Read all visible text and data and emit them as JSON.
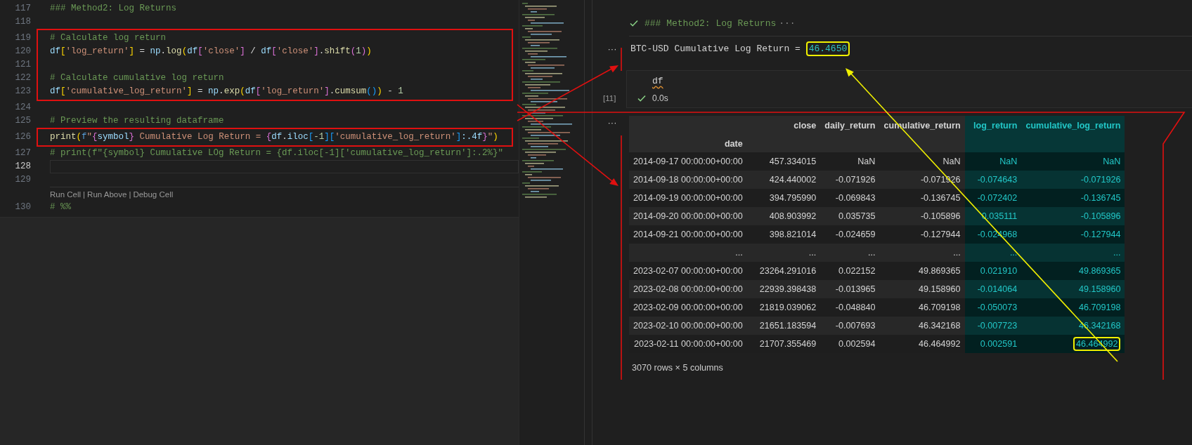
{
  "editor": {
    "groups": [
      {
        "kind": "code",
        "boxed": false,
        "lines": [
          {
            "number": "117",
            "current": false,
            "tokens": [
              {
                "text": "### Method2: Log Returns",
                "kind": "comment"
              }
            ]
          },
          {
            "number": "118",
            "current": false
          }
        ]
      },
      {
        "kind": "code",
        "boxed": true,
        "lines": [
          {
            "number": "119",
            "current": false,
            "tokens": [
              {
                "text": "# Calculate log return",
                "kind": "comment"
              }
            ]
          },
          {
            "number": "120",
            "current": false,
            "tokens": [
              {
                "text": "df",
                "kind": "var"
              },
              {
                "text": "[",
                "kind": "b1"
              },
              {
                "text": "'log_return'",
                "kind": "str"
              },
              {
                "text": "]",
                "kind": "b1"
              },
              {
                "text": " = ",
                "kind": "op"
              },
              {
                "text": "np",
                "kind": "var"
              },
              {
                "text": ".",
                "kind": "op"
              },
              {
                "text": "log",
                "kind": "fn"
              },
              {
                "text": "(",
                "kind": "b1"
              },
              {
                "text": "df",
                "kind": "var"
              },
              {
                "text": "[",
                "kind": "b2"
              },
              {
                "text": "'close'",
                "kind": "str"
              },
              {
                "text": "]",
                "kind": "b2"
              },
              {
                "text": " / ",
                "kind": "op"
              },
              {
                "text": "df",
                "kind": "var"
              },
              {
                "text": "[",
                "kind": "b2"
              },
              {
                "text": "'close'",
                "kind": "str"
              },
              {
                "text": "]",
                "kind": "b2"
              },
              {
                "text": ".",
                "kind": "op"
              },
              {
                "text": "shift",
                "kind": "fn"
              },
              {
                "text": "(",
                "kind": "b2"
              },
              {
                "text": "1",
                "kind": "num"
              },
              {
                "text": ")",
                "kind": "b2"
              },
              {
                "text": ")",
                "kind": "b1"
              }
            ]
          },
          {
            "number": "121",
            "current": false
          },
          {
            "number": "122",
            "current": false,
            "tokens": [
              {
                "text": "# Calculate cumulative log return",
                "kind": "comment"
              }
            ]
          },
          {
            "number": "123",
            "current": false,
            "tokens": [
              {
                "text": "df",
                "kind": "var"
              },
              {
                "text": "[",
                "kind": "b1"
              },
              {
                "text": "'cumulative_log_return'",
                "kind": "str"
              },
              {
                "text": "]",
                "kind": "b1"
              },
              {
                "text": " = ",
                "kind": "op"
              },
              {
                "text": "np",
                "kind": "var"
              },
              {
                "text": ".",
                "kind": "op"
              },
              {
                "text": "exp",
                "kind": "fn"
              },
              {
                "text": "(",
                "kind": "b1"
              },
              {
                "text": "df",
                "kind": "var"
              },
              {
                "text": "[",
                "kind": "b2"
              },
              {
                "text": "'log_return'",
                "kind": "str"
              },
              {
                "text": "]",
                "kind": "b2"
              },
              {
                "text": ".",
                "kind": "op"
              },
              {
                "text": "cumsum",
                "kind": "fn"
              },
              {
                "text": "()",
                "kind": "b3"
              },
              {
                "text": ")",
                "kind": "b1"
              },
              {
                "text": " - ",
                "kind": "op"
              },
              {
                "text": "1",
                "kind": "num"
              }
            ]
          }
        ]
      },
      {
        "kind": "code",
        "boxed": false,
        "lines": [
          {
            "number": "124",
            "current": false
          },
          {
            "number": "125",
            "current": false,
            "tokens": [
              {
                "text": "# Preview the resulting dataframe",
                "kind": "comment"
              }
            ]
          }
        ]
      },
      {
        "kind": "code",
        "boxed": true,
        "lines": [
          {
            "number": "126",
            "current": false,
            "tokens": [
              {
                "text": "print",
                "kind": "fn"
              },
              {
                "text": "(",
                "kind": "b1"
              },
              {
                "text": "f",
                "kind": "kw"
              },
              {
                "text": "\"",
                "kind": "str"
              },
              {
                "text": "{",
                "kind": "b2"
              },
              {
                "text": "symbol",
                "kind": "var"
              },
              {
                "text": "}",
                "kind": "b2"
              },
              {
                "text": " Cumulative Log Return = ",
                "kind": "str"
              },
              {
                "text": "{",
                "kind": "b2"
              },
              {
                "text": "df",
                "kind": "var"
              },
              {
                "text": ".",
                "kind": "op"
              },
              {
                "text": "iloc",
                "kind": "var"
              },
              {
                "text": "[",
                "kind": "b3"
              },
              {
                "text": "-1",
                "kind": "num"
              },
              {
                "text": "]",
                "kind": "b3"
              },
              {
                "text": "[",
                "kind": "b3"
              },
              {
                "text": "'cumulative_log_return'",
                "kind": "str"
              },
              {
                "text": "]",
                "kind": "b3"
              },
              {
                "text": ":.4f",
                "kind": "var"
              },
              {
                "text": "}",
                "kind": "b2"
              },
              {
                "text": "\"",
                "kind": "str"
              },
              {
                "text": ")",
                "kind": "b1"
              }
            ]
          }
        ]
      },
      {
        "kind": "code",
        "boxed": false,
        "lines": [
          {
            "number": "127",
            "current": false,
            "tokens": [
              {
                "text": "# print(f\"{symbol} Cumulative LOg Return = {df.iloc[-1]['cumulative_log_return']:.2%}\"",
                "kind": "comment"
              }
            ]
          },
          {
            "number": "128",
            "current": true
          },
          {
            "number": "129",
            "current": false
          }
        ]
      },
      {
        "kind": "codelens",
        "links": [
          "Run Cell",
          "Run Above",
          "Debug Cell"
        ],
        "separator": "|"
      },
      {
        "kind": "code",
        "boxed": false,
        "lines": [
          {
            "number": "130",
            "current": false,
            "tokens": [
              {
                "text": "# %%",
                "kind": "comment"
              }
            ]
          }
        ]
      }
    ]
  },
  "notebook": {
    "markdown_cell": {
      "text": "### Method2: Log Returns",
      "more": "···"
    },
    "print_output": {
      "more": "···",
      "text": "BTC-USD Cumulative Log Return = ",
      "value": "46.4650",
      "annotated": true
    },
    "code_cell": {
      "code": "df",
      "warning": true,
      "execution_count": "[11]",
      "duration": "0.0s"
    },
    "table_output": {
      "more": "···",
      "index_name": "date",
      "columns": [
        {
          "label": "close",
          "highlighted": false
        },
        {
          "label": "daily_return",
          "highlighted": false
        },
        {
          "label": "cumulative_return",
          "highlighted": false
        },
        {
          "label": "log_return",
          "highlighted": true
        },
        {
          "label": "cumulative_log_return",
          "highlighted": true
        }
      ],
      "rows": [
        {
          "index": "2014-09-17 00:00:00+00:00",
          "cells": [
            "457.334015",
            "NaN",
            "NaN",
            "NaN",
            "NaN"
          ],
          "annotated": false
        },
        {
          "index": "2014-09-18 00:00:00+00:00",
          "cells": [
            "424.440002",
            "-0.071926",
            "-0.071926",
            "-0.074643",
            "-0.071926"
          ],
          "annotated": false
        },
        {
          "index": "2014-09-19 00:00:00+00:00",
          "cells": [
            "394.795990",
            "-0.069843",
            "-0.136745",
            "-0.072402",
            "-0.136745"
          ],
          "annotated": false
        },
        {
          "index": "2014-09-20 00:00:00+00:00",
          "cells": [
            "408.903992",
            "0.035735",
            "-0.105896",
            "0.035111",
            "-0.105896"
          ],
          "annotated": false
        },
        {
          "index": "2014-09-21 00:00:00+00:00",
          "cells": [
            "398.821014",
            "-0.024659",
            "-0.127944",
            "-0.024968",
            "-0.127944"
          ],
          "annotated": false
        },
        {
          "index": "...",
          "cells": [
            "...",
            "...",
            "...",
            "...",
            "..."
          ],
          "annotated": false
        },
        {
          "index": "2023-02-07 00:00:00+00:00",
          "cells": [
            "23264.291016",
            "0.022152",
            "49.869365",
            "0.021910",
            "49.869365"
          ],
          "annotated": false
        },
        {
          "index": "2023-02-08 00:00:00+00:00",
          "cells": [
            "22939.398438",
            "-0.013965",
            "49.158960",
            "-0.014064",
            "49.158960"
          ],
          "annotated": false
        },
        {
          "index": "2023-02-09 00:00:00+00:00",
          "cells": [
            "21819.039062",
            "-0.048840",
            "46.709198",
            "-0.050073",
            "46.709198"
          ],
          "annotated": false
        },
        {
          "index": "2023-02-10 00:00:00+00:00",
          "cells": [
            "21651.183594",
            "-0.007693",
            "46.342168",
            "-0.007723",
            "46.342168"
          ],
          "annotated": false
        },
        {
          "index": "2023-02-11 00:00:00+00:00",
          "cells": [
            "21707.355469",
            "0.002594",
            "46.464992",
            "0.002591",
            "46.464992"
          ],
          "annotated": true
        }
      ],
      "footer": "3070 rows × 5 columns"
    }
  }
}
